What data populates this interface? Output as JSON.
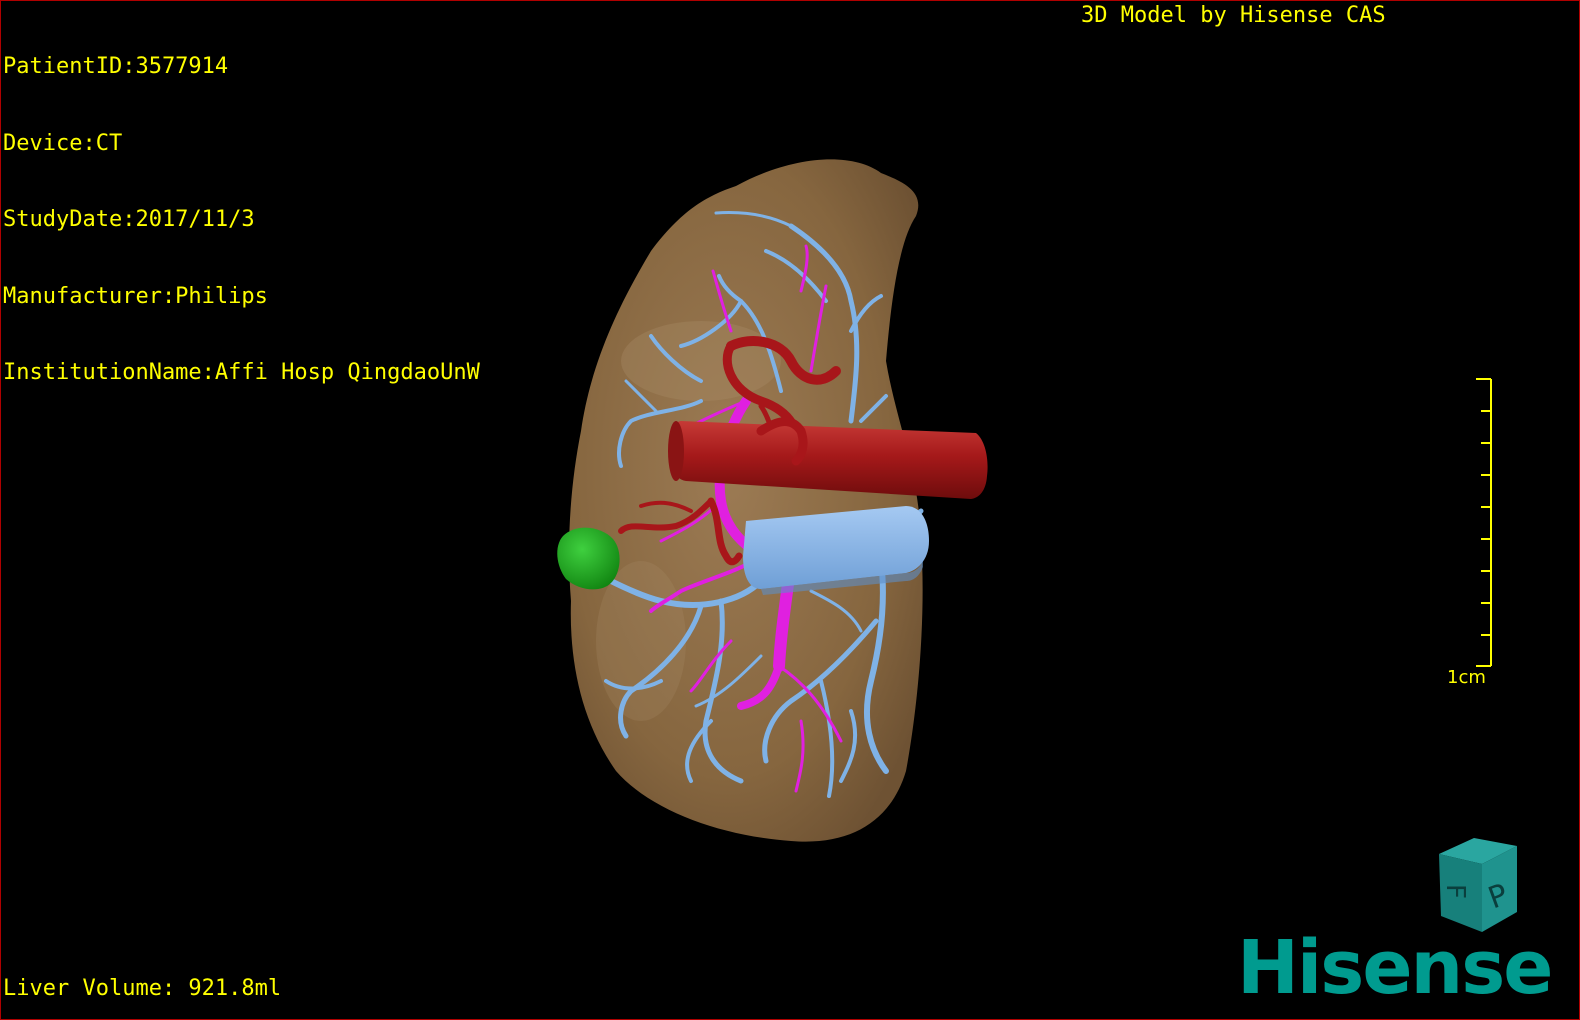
{
  "overlay": {
    "patient_id": "PatientID:3577914",
    "device": "Device:CT",
    "study_date": "StudyDate:2017/11/3",
    "manufacturer": "Manufacturer:Philips",
    "institution": "InstitutionName:Affi Hosp QingdaoUnW",
    "model_credit": "3D Model by Hisense CAS",
    "liver_volume": "Liver Volume: 921.8ml"
  },
  "scale_bar": {
    "label": "1cm",
    "color": "#ffff00"
  },
  "orientation_cube": {
    "face_labels": [
      "F",
      "P"
    ],
    "color": "#1d8a86"
  },
  "brand": {
    "logo_text": "Hisense",
    "color": "#009b8f"
  },
  "model_colors": {
    "liver": "#8a6a45",
    "portal_vein": "#7fb2e6",
    "hepatic_artery": "#b8181c",
    "bile_duct": "#e020e0",
    "tumor": "#1fa51f",
    "vena_cava": "#8fb6ea"
  }
}
